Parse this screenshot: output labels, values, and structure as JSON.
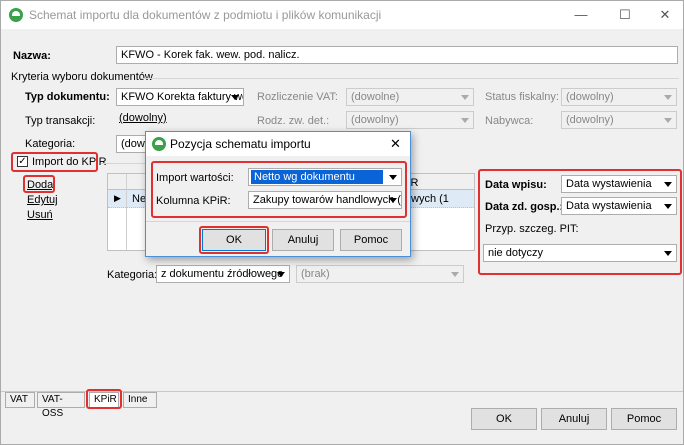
{
  "window": {
    "title": "Schemat importu dla dokumentów z podmiotu i plików komunikacji",
    "minimize": "—",
    "maximize": "☐",
    "close": "✕"
  },
  "form": {
    "nazwa_label": "Nazwa:",
    "nazwa_value": "KFWO - Korek fak. wew. pod. nalicz.",
    "kryteria_label": "Kryteria wyboru dokumentów",
    "typ_dok_label": "Typ dokumentu:",
    "typ_dok_value": "KFWO Korekta faktury we",
    "typ_trans_label": "Typ transakcji:",
    "typ_trans_value": "(dowolny)",
    "kategoria_label": "Kategoria:",
    "kategoria_value": "(dowo",
    "rozliczenie_vat_label": "Rozliczenie VAT:",
    "rozliczenie_vat_value": "(dowolne)",
    "rodz_zw_label": "Rodz. zw. det.:",
    "rodz_zw_value": "(dowolny)",
    "status_fiskalny_label": "Status fiskalny:",
    "status_fiskalny_value": "(dowolny)",
    "nabywca_label": "Nabywca:",
    "nabywca_value": "(dowolny)",
    "import_kpir_label": "Import do KPiR",
    "import_kpir_checked": "✓"
  },
  "actions": {
    "dodaj": "Dodaj",
    "edytuj": "Edytuj",
    "usun": "Usuń"
  },
  "grid": {
    "header_fragment": "iR",
    "row_prefix": "Ne",
    "row_suffix": "llowych (1",
    "row_marker": "▶"
  },
  "kategoria_bottom": {
    "label": "Kategoria:",
    "value": "z dokumentu źródłowego",
    "brak": "(brak)"
  },
  "right_panel": {
    "data_wpisu_label": "Data wpisu:",
    "data_wpisu_value": "Data wystawienia",
    "data_zd_label": "Data zd. gosp.:",
    "data_zd_value": "Data wystawienia",
    "przyp_label": "Przyp. szczeg. PIT:",
    "przyp_value": "nie dotyczy"
  },
  "dialog": {
    "title": "Pozycja schematu importu",
    "close": "✕",
    "import_label": "Import wartości:",
    "import_value": "Netto wg dokumentu",
    "kolumna_label": "Kolumna KPiR:",
    "kolumna_value": "Zakupy towarów handlowych (1(",
    "ok": "OK",
    "anuluj": "Anuluj",
    "pomoc": "Pomoc"
  },
  "tabs": [
    "VAT",
    "VAT-OSS",
    "KPiR",
    "Inne"
  ],
  "footer": {
    "ok": "OK",
    "anuluj": "Anuluj",
    "pomoc": "Pomoc"
  },
  "colors": {
    "highlight": "#e0302f",
    "selection": "#0a64d8",
    "brand_icon": "#3aa04a"
  }
}
